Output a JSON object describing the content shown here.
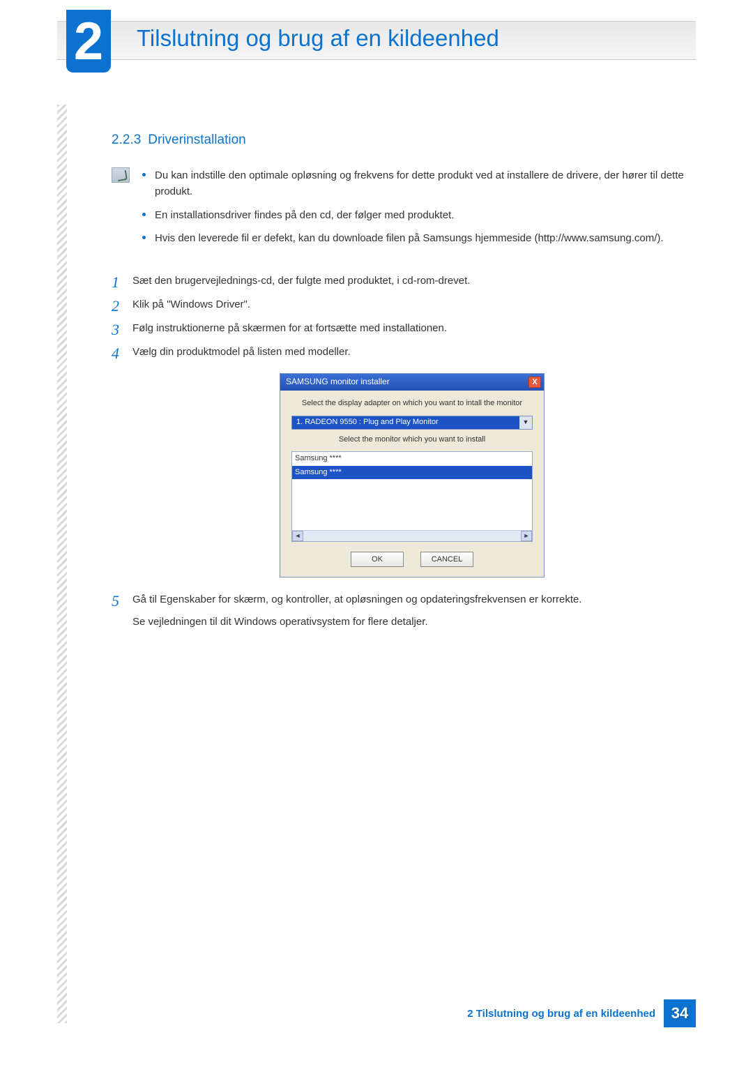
{
  "header": {
    "chapter_number": "2",
    "chapter_title": "Tilslutning og brug af en kildeenhed"
  },
  "section": {
    "number": "2.2.3",
    "title": "Driverinstallation"
  },
  "notes": [
    "Du kan indstille den optimale opløsning og frekvens for dette produkt ved at installere de drivere, der hører til dette produkt.",
    "En installationsdriver findes på den cd, der følger med produktet.",
    "Hvis den leverede fil er defekt, kan du downloade filen på Samsungs hjemmeside (http://www.samsung.com/)."
  ],
  "steps": {
    "s1": {
      "num": "1",
      "text": "Sæt den brugervejlednings-cd, der fulgte med produktet, i cd-rom-drevet."
    },
    "s2": {
      "num": "2",
      "text": "Klik på \"Windows Driver\"."
    },
    "s3": {
      "num": "3",
      "text": "Følg instruktionerne på skærmen for at fortsætte med installationen."
    },
    "s4": {
      "num": "4",
      "text": "Vælg din produktmodel på listen med modeller."
    },
    "s5": {
      "num": "5",
      "text": "Gå til Egenskaber for skærm, og kontroller, at opløsningen og opdateringsfrekvensen er korrekte.",
      "extra": "Se vejledningen til dit Windows operativsystem for flere detaljer."
    }
  },
  "installer": {
    "title": "SAMSUNG monitor installer",
    "close": "X",
    "label_top": "Select the display adapter on which you want to intall the monitor",
    "adapter": "1. RADEON 9550 : Plug and Play Monitor",
    "label_mid": "Select the monitor which you want to install",
    "list_item_1": "Samsung ****",
    "list_item_2": "Samsung ****",
    "ok": "OK",
    "cancel": "CANCEL"
  },
  "footer": {
    "text": "2 Tilslutning og brug af en kildeenhed",
    "page": "34"
  }
}
